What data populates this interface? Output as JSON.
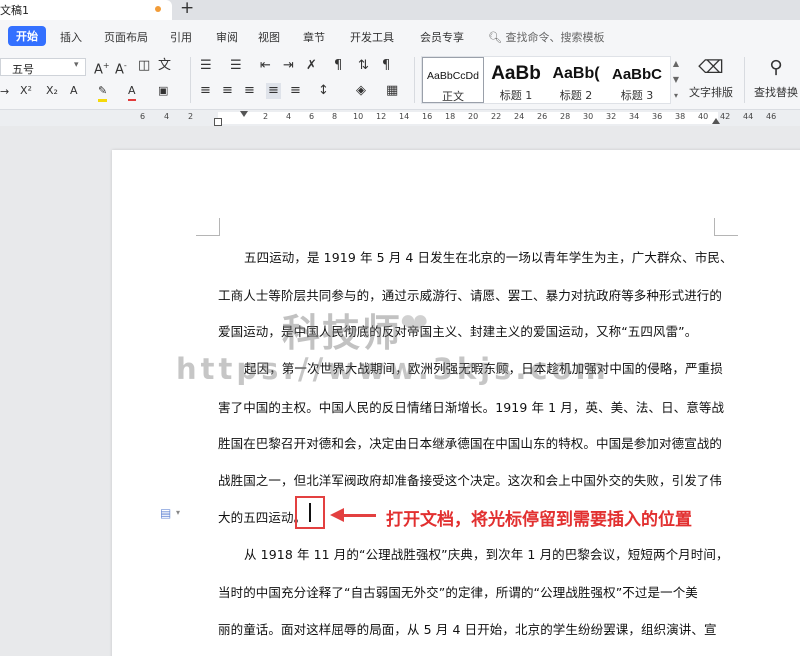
{
  "tab": {
    "title": "文稿1",
    "new_tab": "+"
  },
  "menu": {
    "items": [
      "开始",
      "插入",
      "页面布局",
      "引用",
      "审阅",
      "视图",
      "章节",
      "开发工具",
      "会员专享"
    ],
    "search": "查找命令、搜索模板"
  },
  "ribbon": {
    "font_size": "五号",
    "styles": [
      {
        "sample": "AaBbCcDd",
        "name": "正文"
      },
      {
        "sample": "AaBb",
        "name": "标题 1"
      },
      {
        "sample": "AaBb(",
        "name": "标题 2"
      },
      {
        "sample": "AaBbC",
        "name": "标题 3"
      }
    ],
    "text_layout": "文字排版",
    "find_replace": "查找替换"
  },
  "ruler": {
    "numbers": [
      "6",
      "4",
      "2",
      "2",
      "4",
      "6",
      "8",
      "10",
      "12",
      "14",
      "16",
      "18",
      "20",
      "22",
      "24",
      "26",
      "28",
      "30",
      "32",
      "34",
      "36",
      "38",
      "40",
      "42",
      "44",
      "46"
    ]
  },
  "document": {
    "lines": [
      "五四运动，是 1919 年 5 月 4 日发生在北京的一场以青年学生为主，广大群众、市民、",
      "工商人士等阶层共同参与的，通过示威游行、请愿、罢工、暴力对抗政府等多种形式进行的",
      "爱国运动，是中国人民彻底的反对帝国主义、封建主义的爱国运动，又称“五四风雷”。",
      "起因，第一次世界大战期间，欧洲列强无暇东顾，日本趁机加强对中国的侵略，严重损",
      "害了中国的主权。中国人民的反日情绪日渐增长。1919 年 1 月，英、美、法、日、意等战",
      "胜国在巴黎召开对德和会，决定由日本继承德国在中国山东的特权。中国是参加对德宣战的",
      "战胜国之一，但北洋军阀政府却准备接受这个决定。这次和会上中国外交的失败，引发了伟",
      "大的五四运动。",
      "从 1918 年 11 月的“公理战胜强权”庆典，到次年 1 月的巴黎会议，短短两个月时间，",
      "当时的中国充分诠释了“自古弱国无外交”的定律，所谓的“公理战胜强权”不过是一个美",
      "丽的童话。面对这样屈辱的局面，从 5 月 4 日开始，北京的学生纷纷罢课，组织演讲、宣"
    ],
    "watermark_main": "科技师",
    "watermark_url": "https://www.3kjs.com",
    "annotation": "打开文档，将光标停留到需要插入的位置"
  }
}
